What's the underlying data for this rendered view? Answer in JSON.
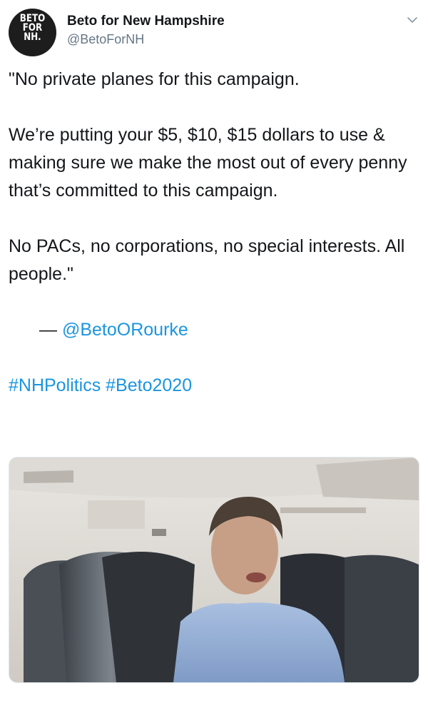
{
  "account": {
    "display_name": "Beto for New Hampshire",
    "handle": "@BetoForNH",
    "avatar_lines": [
      "BETO",
      "FOR",
      "NH."
    ]
  },
  "tweet": {
    "line1": "\"No private planes for this campaign.",
    "para2": "We’re putting your $5, $10, $15 dollars to use & making sure we make the most out of every penny that’s committed to this campaign.",
    "para3": "No PACs, no corporations, no special interests. All people.\"",
    "attribution_dash": "— ",
    "attribution_mention": "@BetoORourke",
    "hashtag1": "#NHPolitics",
    "hashtag2": "#Beto2020"
  },
  "icons": {
    "menu": "chevron-down-icon"
  },
  "colors": {
    "link": "#1b95e0",
    "secondary_text": "#657786",
    "primary_text": "#14171a"
  }
}
